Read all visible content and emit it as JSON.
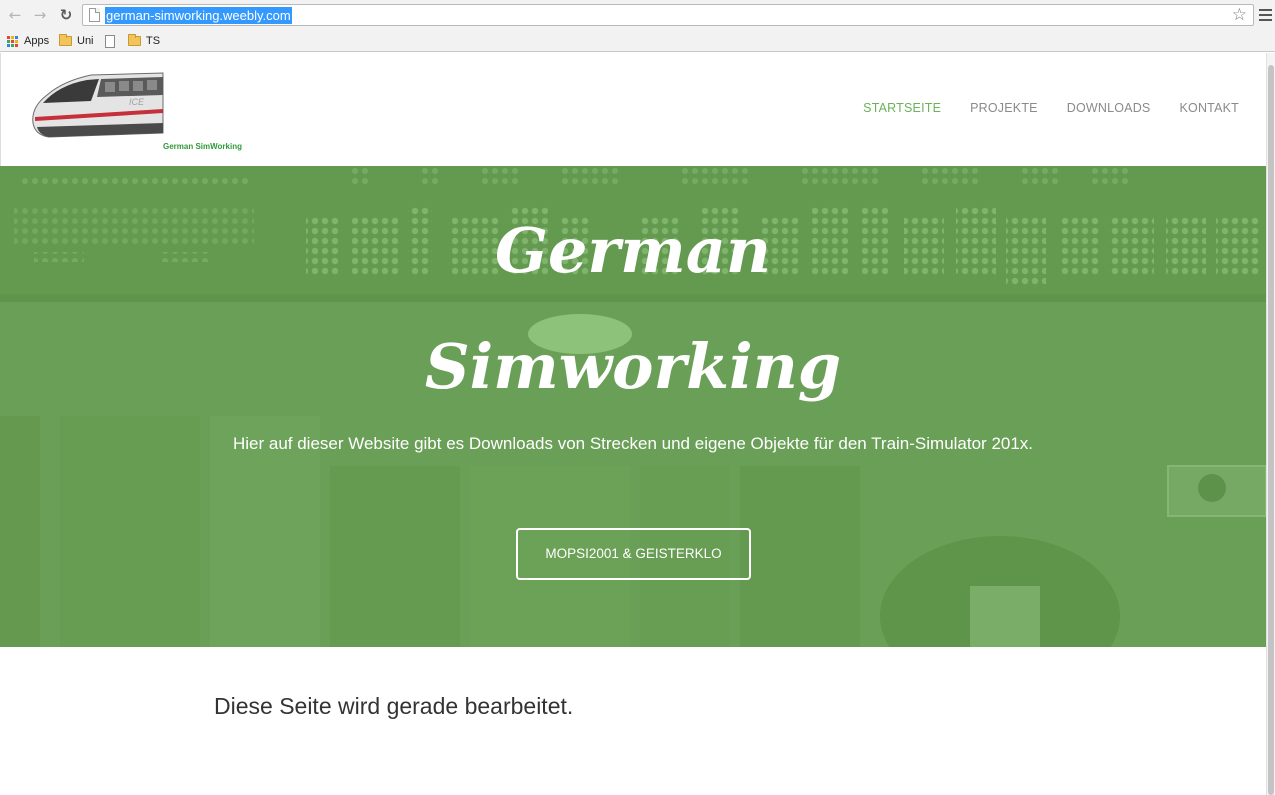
{
  "browser": {
    "url": "german-simworking.weebly.com",
    "icons": [
      "back-arrow-icon",
      "forward-arrow-icon",
      "reload-icon",
      "page-icon",
      "bookmark-star-icon",
      "menu-icon"
    ],
    "bookmarks": [
      {
        "label": "Apps",
        "icon": "apps-grid-icon"
      },
      {
        "label": "Uni",
        "icon": "folder-icon"
      },
      {
        "label": "",
        "icon": "document-icon"
      },
      {
        "label": "TS",
        "icon": "folder-icon"
      }
    ]
  },
  "site": {
    "logo_text": "German SimWorking",
    "nav": [
      {
        "label": "STARTSEITE",
        "active": true
      },
      {
        "label": "PROJEKTE",
        "active": false
      },
      {
        "label": "DOWNLOADS",
        "active": false
      },
      {
        "label": "KONTAKT",
        "active": false
      }
    ],
    "hero": {
      "title_line1": "German",
      "title_line2": "Simworking",
      "subtitle": "Hier auf dieser Website gibt es Downloads von Strecken und eigene Objekte für den Train-Simulator 201x.",
      "button_label": "MOPSI2001 & GEISTERKLO"
    },
    "content_text": "Diese Seite wird gerade bearbeitet."
  },
  "colors": {
    "accent": "#6bb25a",
    "hero_overlay": "#6a9f57",
    "selection": "#3399ff"
  }
}
